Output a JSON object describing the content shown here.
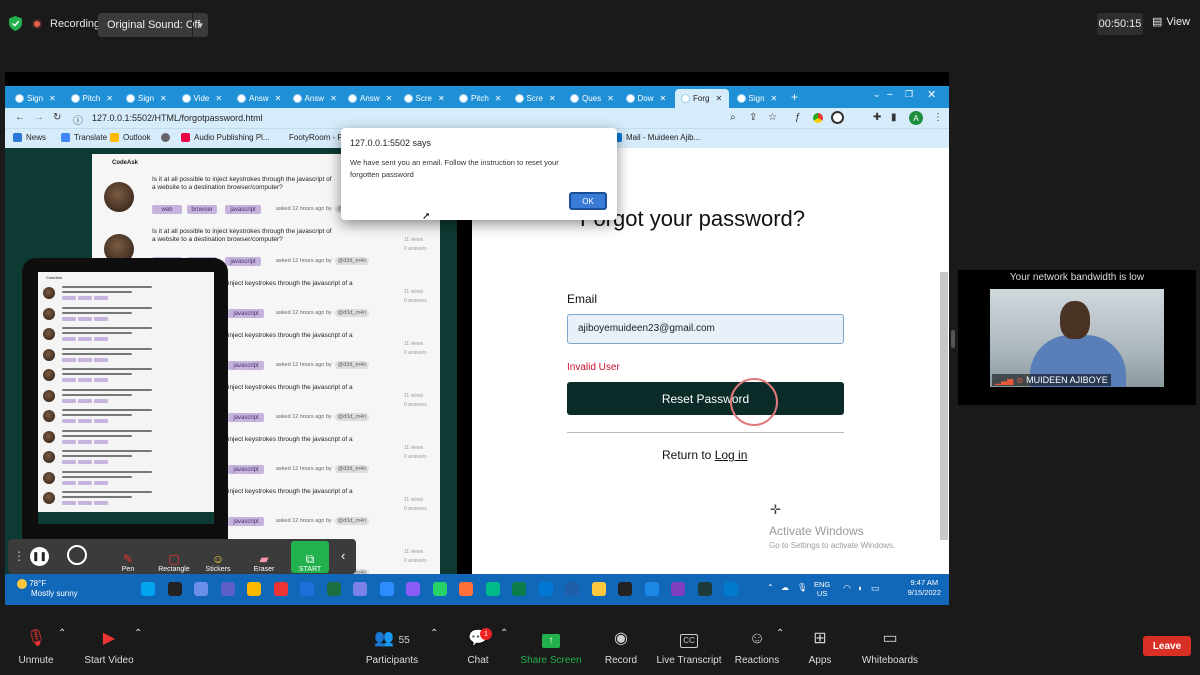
{
  "zoom_top": {
    "recording_label": "Recording",
    "original_sound": "Original Sound: Off",
    "timer": "00:50:15",
    "view_label": "View"
  },
  "browser": {
    "tabs": [
      {
        "label": "Sign",
        "active": false
      },
      {
        "label": "Pitch",
        "active": false
      },
      {
        "label": "Sign",
        "active": false
      },
      {
        "label": "Vide",
        "active": false
      },
      {
        "label": "Answ",
        "active": false
      },
      {
        "label": "Answ",
        "active": false
      },
      {
        "label": "Answ",
        "active": false
      },
      {
        "label": "Scre",
        "active": false
      },
      {
        "label": "Pitch",
        "active": false
      },
      {
        "label": "Scre",
        "active": false
      },
      {
        "label": "Ques",
        "active": false
      },
      {
        "label": "Dow",
        "active": false
      },
      {
        "label": "Forg",
        "active": true
      },
      {
        "label": "Sign",
        "active": false
      }
    ],
    "url": "127.0.0.1:5502/HTML/forgotpassword.html",
    "bookmarks": [
      "News",
      "Translate",
      "Outlook",
      "Audio Publishing Pl...",
      "FootyRoom - F",
      "Mail - Muideen Ajib..."
    ]
  },
  "alert": {
    "origin": "127.0.0.1:5502 says",
    "message": "We have sent you an email. Follow the instruction to reset your forgotten password",
    "ok_label": "OK"
  },
  "forgot_page": {
    "title": "Forgot your password?",
    "email_label": "Email",
    "email_value": "ajiboyemuideen23@gmail.com",
    "error": "Invalid User",
    "reset_button": "Reset Password",
    "return_text": "Return to",
    "login_link": "Log in"
  },
  "mockup": {
    "logo": "CodeAsk",
    "question": "Is it at all possible to inject keystrokes through the javascript of a website to a destination browser/computer?",
    "question_partial": "inject keystrokes through the javascript of a",
    "question_partial2": "on browser/computer?",
    "asked": "asked 12 hours ago by",
    "user": "@d3d_m4n",
    "tags": [
      "web",
      "browser",
      "javascript"
    ],
    "views": "11 views",
    "answers": "0 answers"
  },
  "activate_windows": {
    "title": "Activate Windows",
    "subtitle": "Go to Settings to activate Windows."
  },
  "draw_toolbar": {
    "tools": [
      "Pen",
      "Rectangle",
      "Stickers",
      "Eraser",
      "START"
    ]
  },
  "taskbar": {
    "temp": "78°F",
    "weather": "Mostly sunny",
    "lang1": "ENG",
    "lang2": "US",
    "time": "9:47 AM",
    "date": "9/15/2022"
  },
  "video": {
    "bandwidth_warning": "Your network bandwidth is low",
    "participant_name": "MUIDEEN AJIBOYE"
  },
  "zoom_bottom": {
    "unmute": "Unmute",
    "start_video": "Start Video",
    "participants_count": "55",
    "participants": "Participants",
    "chat": "Chat",
    "chat_badge": "1",
    "share_screen": "Share Screen",
    "record": "Record",
    "live_transcript": "Live Transcript",
    "reactions": "Reactions",
    "apps": "Apps",
    "whiteboards": "Whiteboards",
    "leave": "Leave"
  },
  "colors": {
    "tab_bar": "#1f8fd6",
    "taskbar": "#1167b8",
    "reset_button": "#0a2b28",
    "share_green": "#23b14d",
    "leave_red": "#d93025",
    "error_red": "#c8102e"
  }
}
